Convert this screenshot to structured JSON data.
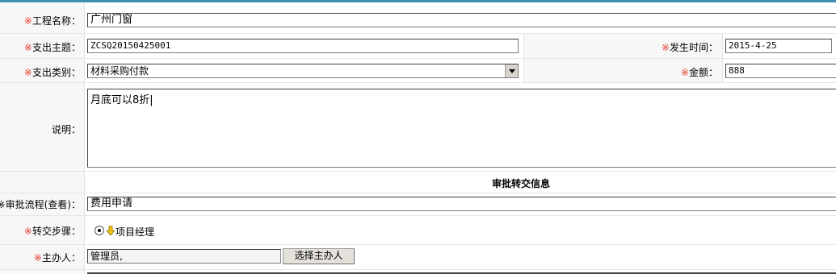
{
  "form": {
    "required_mark": "※",
    "project_name": {
      "label": "工程名称：",
      "value": "广州门窗"
    },
    "expense_subject": {
      "label": "支出主题：",
      "value": "ZCSQ20150425001"
    },
    "occur_time": {
      "label": "发生时间：",
      "value": "2015-4-25"
    },
    "expense_type": {
      "label": "支出类别：",
      "value": "材料采购付款"
    },
    "amount": {
      "label": "金额：",
      "value": "888"
    },
    "description": {
      "label": "说明：",
      "value": "月底可以8折|"
    }
  },
  "approval": {
    "section_title": "审批转交信息",
    "flow": {
      "label_prefix": "※审批流程",
      "view_link": "(查看)",
      "label_suffix": "：",
      "value": "费用申请"
    },
    "step": {
      "label": "转交步骤：",
      "option": "项目经理"
    },
    "handler": {
      "label": "主办人：",
      "value": "管理员,",
      "button": "选择主办人"
    }
  },
  "colors": {
    "accent": "#3c8fb0",
    "required": "#e23b2e"
  },
  "icons": {
    "step_arrow": "down-arrow-icon"
  }
}
